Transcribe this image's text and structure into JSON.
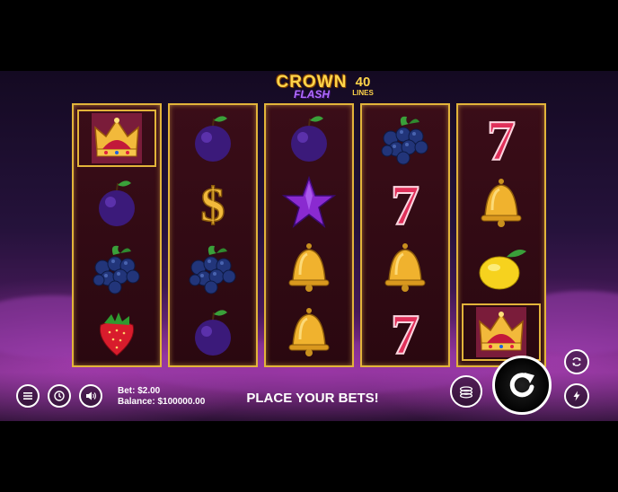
{
  "logo": {
    "title": "CROWN",
    "subtitle": "FLASH",
    "lines_number": "40",
    "lines_label": "LINES"
  },
  "reels": [
    [
      "crown",
      "plum",
      "blueberries",
      "strawberry"
    ],
    [
      "plum",
      "dollar",
      "blueberries",
      "plum"
    ],
    [
      "plum",
      "star",
      "bell",
      "bell"
    ],
    [
      "blueberries",
      "seven",
      "bell",
      "seven"
    ],
    [
      "seven",
      "bell",
      "lemon",
      "crown"
    ]
  ],
  "highlighted": [
    [
      0,
      0
    ],
    [
      4,
      3
    ]
  ],
  "controls": {
    "bet": "Bet: $2.00",
    "balance": "Balance: $100000.00",
    "message": "PLACE YOUR BETS!"
  },
  "icons": {
    "menu": "menu-icon",
    "history": "history-icon",
    "sound": "sound-icon",
    "coins": "coins-icon",
    "spin": "spin-icon",
    "autoplay": "autoplay-icon",
    "turbo": "turbo-icon"
  },
  "colors": {
    "frame": "#e2b43a",
    "background": "#25123b",
    "text": "#ffffff"
  }
}
